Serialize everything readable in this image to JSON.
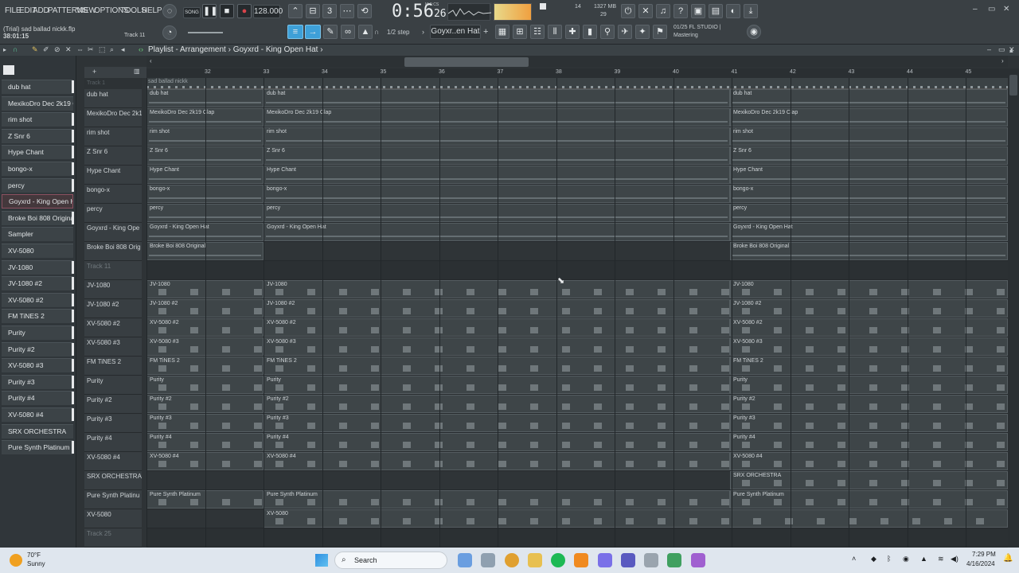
{
  "menu": [
    "FILE",
    "EDIT",
    "ADD",
    "PATTERNS",
    "VIEW",
    "OPTIONS",
    "TOOLS",
    "HELP"
  ],
  "transport": {
    "pattern_song": "SONG",
    "tempo": "128.000",
    "time": "0:56",
    "time_sub": "26",
    "time_label": "M:S:CS",
    "memory": "1327 MB",
    "cpu_top": "14",
    "cpu_bottom": "29"
  },
  "hint": {
    "title": "(Trial) sad ballad nickk.flp",
    "time": "38:01:15",
    "track": "Track 11"
  },
  "snap": {
    "label": "1/2 step",
    "pattern": "Goyxr..en Hat"
  },
  "studio": {
    "line1": "01/25 FL STUDIO |",
    "line2": "Mastering"
  },
  "playlist": {
    "title": "Playlist - Arrangement",
    "pattern": "Goyxrd - King Open Hat",
    "track1": "Track 1",
    "song_clip": "sad ballad nickk"
  },
  "ruler": [
    "32",
    "33",
    "34",
    "35",
    "36",
    "37",
    "38",
    "39",
    "40",
    "41",
    "42",
    "43",
    "44",
    "45"
  ],
  "picker": [
    {
      "label": "dub hat",
      "bar": true
    },
    {
      "label": "MexikoDro Dec 2k19 Clap",
      "bar": false
    },
    {
      "label": "rim shot",
      "bar": true
    },
    {
      "label": "Z Snr 6",
      "bar": true
    },
    {
      "label": "Hype Chant",
      "bar": true
    },
    {
      "label": "bongo-x",
      "bar": true
    },
    {
      "label": "percy",
      "bar": true
    },
    {
      "label": "Goyxrd - King Open Hat",
      "bar": false,
      "sel": true
    },
    {
      "label": "Broke Boi 808 Original",
      "bar": true
    },
    {
      "label": "Sampler",
      "bar": false
    },
    {
      "label": "XV-5080",
      "bar": false
    },
    {
      "label": "JV-1080",
      "bar": true
    },
    {
      "label": "JV-1080 #2",
      "bar": true
    },
    {
      "label": "XV-5080 #2",
      "bar": true
    },
    {
      "label": "FM TiNES 2",
      "bar": true
    },
    {
      "label": "Purity",
      "bar": true
    },
    {
      "label": "Purity #2",
      "bar": true
    },
    {
      "label": "XV-5080 #3",
      "bar": true
    },
    {
      "label": "Purity #3",
      "bar": true
    },
    {
      "label": "Purity #4",
      "bar": true
    },
    {
      "label": "XV-5080 #4",
      "bar": true
    },
    {
      "label": "SRX ORCHESTRA",
      "bar": false
    },
    {
      "label": "Pure Synth Platinum",
      "bar": true
    }
  ],
  "tracks": [
    {
      "name": "dub hat",
      "clip": "dub hat"
    },
    {
      "name": "MexikoDro Dec 2k1",
      "clip": "MexikoDro Dec 2k19 Clap"
    },
    {
      "name": "rim shot",
      "clip": "rim shot"
    },
    {
      "name": "Z Snr 6",
      "clip": "Z Snr 6"
    },
    {
      "name": "Hype Chant",
      "clip": "Hype Chant"
    },
    {
      "name": "bongo-x",
      "clip": "bongo-x"
    },
    {
      "name": "percy",
      "clip": "percy"
    },
    {
      "name": "Goyxrd - King Ope",
      "clip": "Goyxrd - King Open Hat"
    },
    {
      "name": "Broke Boi 808 Orig",
      "clip": "Broke Boi 808 Original"
    },
    {
      "name": "Track 11",
      "clip": ""
    },
    {
      "name": "JV-1080",
      "clip": "JV-1080"
    },
    {
      "name": "JV-1080 #2",
      "clip": "JV-1080 #2"
    },
    {
      "name": "XV-5080 #2",
      "clip": "XV-5080 #2"
    },
    {
      "name": "XV-5080 #3",
      "clip": "XV-5080 #3"
    },
    {
      "name": "FM TiNES 2",
      "clip": "FM TiNES 2"
    },
    {
      "name": "Purity",
      "clip": "Purity"
    },
    {
      "name": "Purity #2",
      "clip": "Purity #2"
    },
    {
      "name": "Purity #3",
      "clip": "Purity #3"
    },
    {
      "name": "Purity #4",
      "clip": "Purity #4"
    },
    {
      "name": "XV-5080 #4",
      "clip": "XV-5080 #4"
    },
    {
      "name": "SRX ORCHESTRA",
      "clip": "SRX ORCHESTRA"
    },
    {
      "name": "Pure Synth Platinu",
      "clip": "Pure Synth Platinum"
    },
    {
      "name": "XV-5080",
      "clip": "XV-5080"
    },
    {
      "name": "Track 25",
      "clip": ""
    }
  ],
  "taskbar": {
    "temp": "70°F",
    "weather": "Sunny",
    "search": "Search",
    "time": "7:29 PM",
    "date": "4/16/2024"
  },
  "colors": {
    "accent": "#3ea0d8",
    "record": "#d8434a",
    "clip_bg": "#3e4548"
  }
}
